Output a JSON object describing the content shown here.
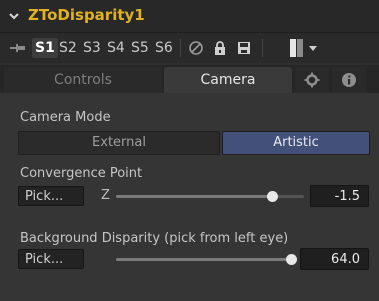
{
  "node": {
    "title": "ZToDisparity1"
  },
  "toolbar": {
    "slots": [
      "S1",
      "S2",
      "S3",
      "S4",
      "S5",
      "S6"
    ],
    "active_slot": "S1",
    "icons": [
      "pin-icon",
      "disable-icon",
      "lock-icon",
      "save-icon",
      "color-swatch-icon",
      "dropdown-arrow-icon"
    ]
  },
  "tabs": {
    "controls": "Controls",
    "camera": "Camera",
    "settings_icon": "gear-icon",
    "info_icon": "info-icon",
    "active": "Camera"
  },
  "camera_mode": {
    "label": "Camera Mode",
    "options": [
      "External",
      "Artistic"
    ],
    "selected": "Artistic"
  },
  "convergence_point": {
    "label": "Convergence Point",
    "pick_label": "Pick...",
    "axis_label": "Z",
    "value": "-1.5",
    "slider_position": 0.83
  },
  "background_disparity": {
    "label": "Background Disparity (pick from left eye)",
    "pick_label": "Pick...",
    "value": "64.0",
    "slider_position": 1.0
  },
  "colors": {
    "title": "#e0b21f",
    "active_option": "#43507a",
    "panel_bg": "#353535"
  }
}
